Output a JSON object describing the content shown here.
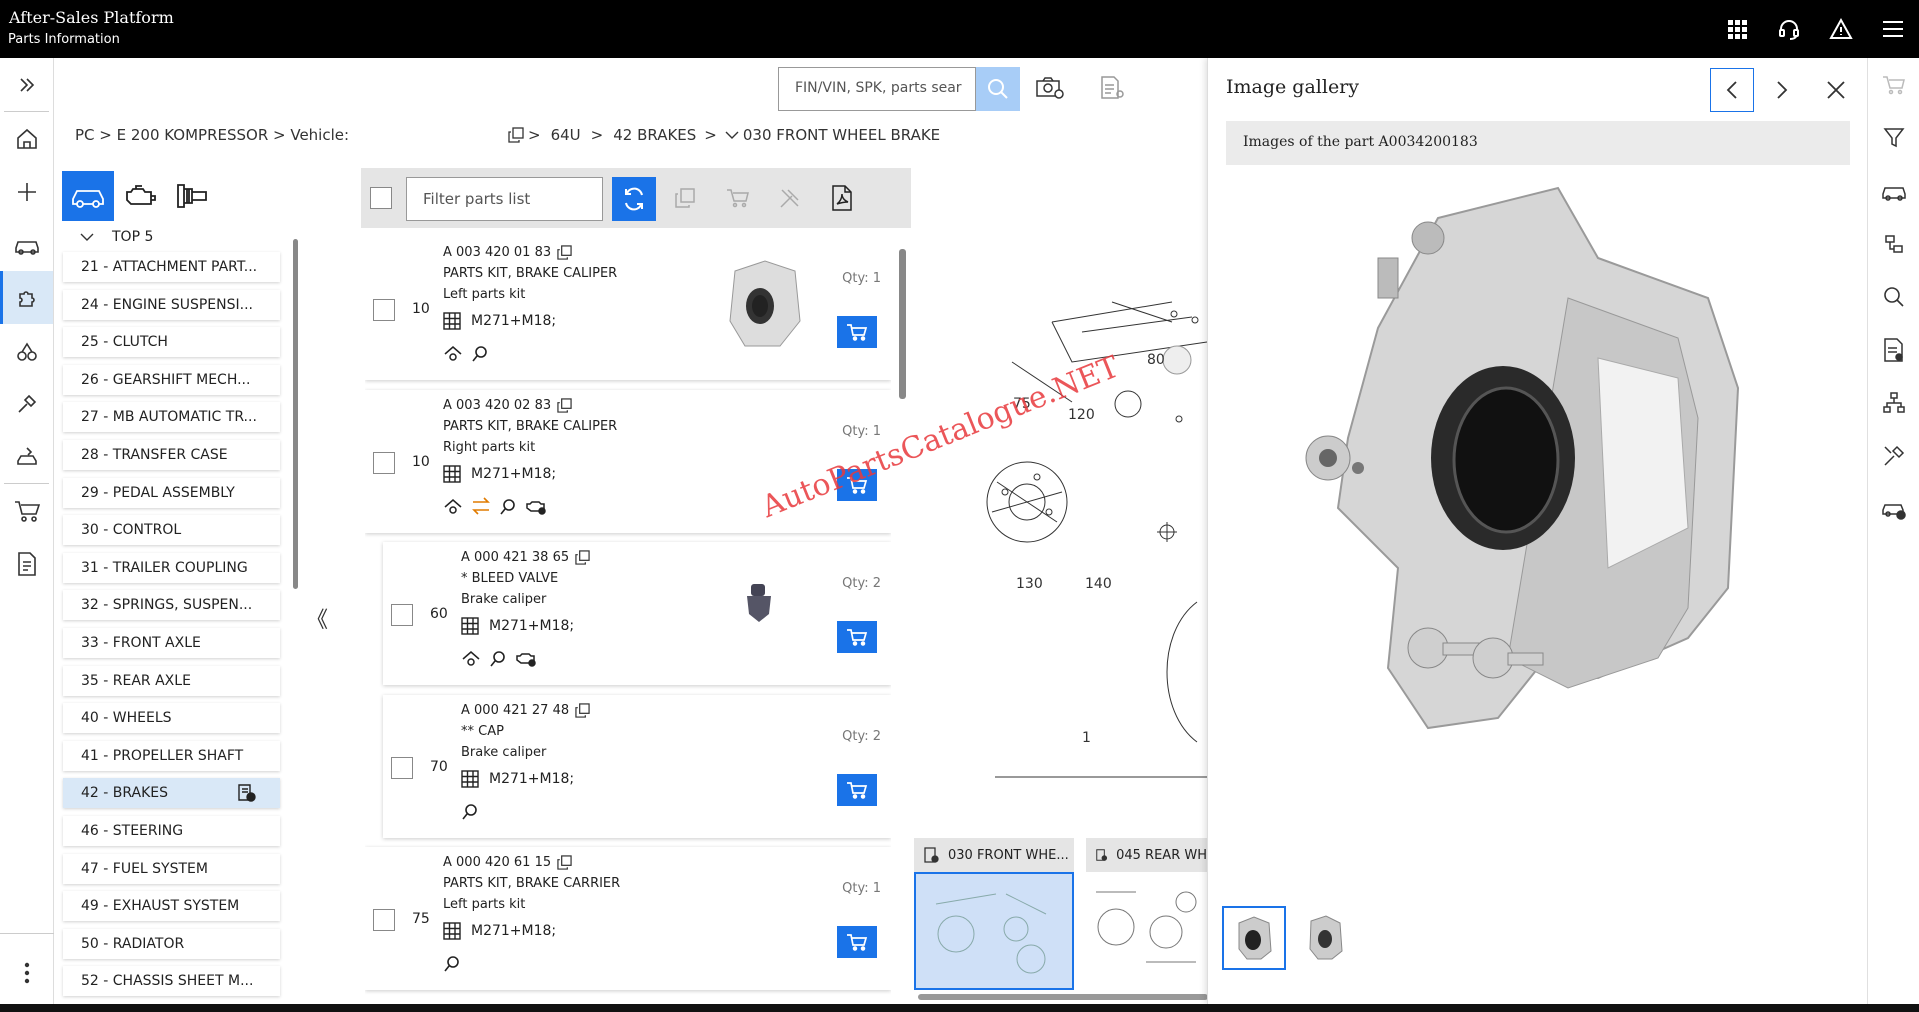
{
  "app": {
    "title": "After-Sales Platform",
    "subtitle": "Parts Information"
  },
  "breadcrumb": {
    "path": "PC > E 200 KOMPRESSOR > Vehicle:",
    "tail_a": "64U",
    "tail_b": "42 BRAKES",
    "tail_c": "030 FRONT WHEEL BRAKE"
  },
  "search": {
    "placeholder": "FIN/VIN, SPK, parts sear"
  },
  "groups": {
    "top_label": "TOP 5",
    "items": [
      "21 - ATTACHMENT PART...",
      "24 - ENGINE SUSPENSI...",
      "25 - CLUTCH",
      "26 - GEARSHIFT MECH...",
      "27 - MB AUTOMATIC TR...",
      "28 - TRANSFER CASE",
      "29 - PEDAL ASSEMBLY",
      "30 - CONTROL",
      "31 - TRAILER COUPLING",
      "32 - SPRINGS, SUSPEN...",
      "33 - FRONT AXLE",
      "35 - REAR AXLE",
      "40 - WHEELS",
      "41 - PROPELLER SHAFT",
      "42 - BRAKES",
      "46 - STEERING",
      "47 - FUEL SYSTEM",
      "49 - EXHAUST SYSTEM",
      "50 - RADIATOR",
      "52 - CHASSIS SHEET M..."
    ],
    "active_index": 14
  },
  "filter": {
    "placeholder": "Filter parts list"
  },
  "parts": [
    {
      "pos": "10",
      "number": "A 003 420 01 83",
      "name": "PARTS KIT, BRAKE CALIPER",
      "desc": "Left parts kit",
      "model": "M271+M18;",
      "qty": "Qty: 1"
    },
    {
      "pos": "10",
      "number": "A 003 420 02 83",
      "name": "PARTS KIT, BRAKE CALIPER",
      "desc": "Right parts kit",
      "model": "M271+M18;",
      "qty": "Qty: 1"
    },
    {
      "pos": "60",
      "number": "A 000 421 38 65",
      "name": "* BLEED VALVE",
      "desc": "Brake caliper",
      "model": "M271+M18;",
      "qty": "Qty: 2"
    },
    {
      "pos": "70",
      "number": "A 000 421 27 48",
      "name": "** CAP",
      "desc": "Brake caliper",
      "model": "M271+M18;",
      "qty": "Qty: 2"
    },
    {
      "pos": "75",
      "number": "A 000 420 61 15",
      "name": "PARTS KIT, BRAKE CARRIER",
      "desc": "Left parts kit",
      "model": "M271+M18;",
      "qty": "Qty: 1"
    }
  ],
  "diagram": {
    "labels": [
      "80",
      "75",
      "120",
      "130",
      "140",
      "1"
    ]
  },
  "bottom_tabs": [
    "030 FRONT WHE...",
    "045 REAR WH"
  ],
  "gallery": {
    "title": "Image gallery",
    "subtitle": "Images of the part A0034200183"
  },
  "watermark": "AutoPartsCatalogue.NET",
  "colors": {
    "accent": "#1a73e8",
    "topbar": "#000000",
    "active_bg": "#d9e8f7",
    "watermark": "#e8393d"
  }
}
